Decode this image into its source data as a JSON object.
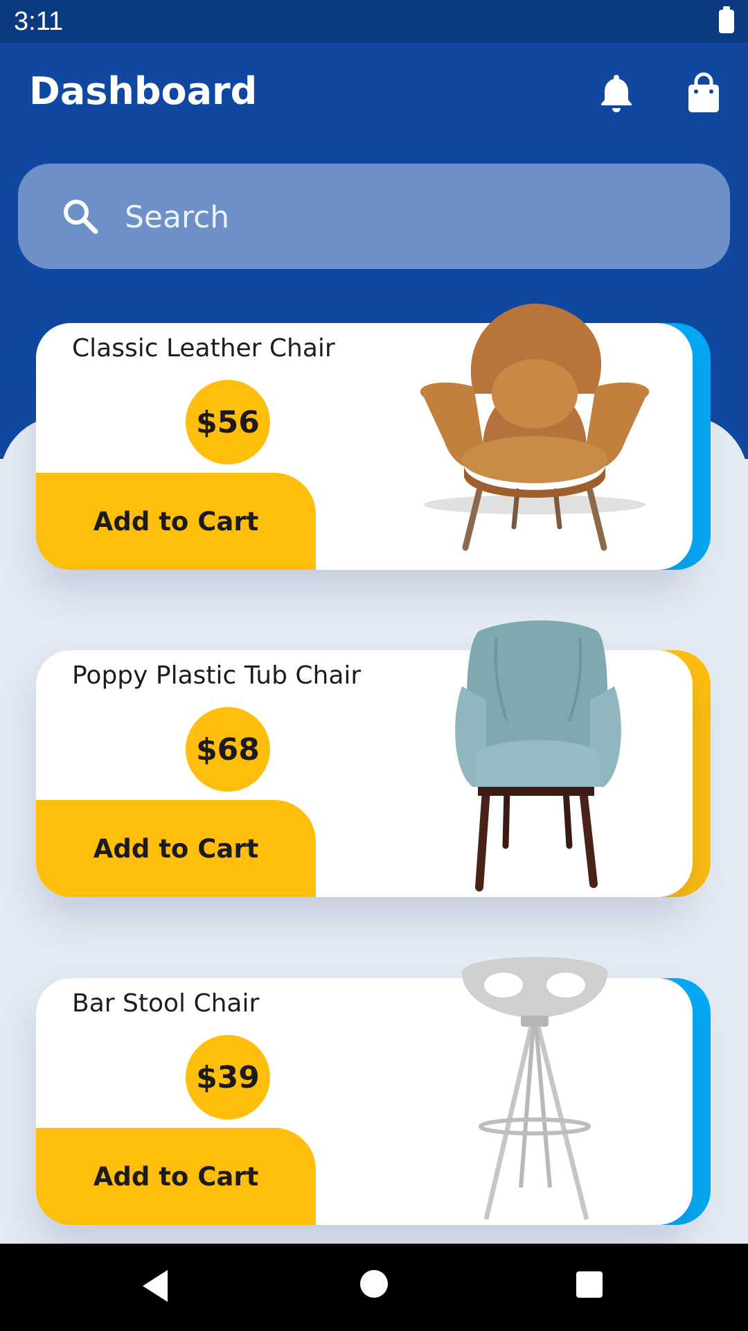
{
  "status_bar": {
    "time": "3:11"
  },
  "header": {
    "title": "Dashboard"
  },
  "search": {
    "placeholder": "Search"
  },
  "colors": {
    "header": "#0f47a1",
    "search": "#6d90c7",
    "yellow": "#ffbe0b",
    "blue_accent": "#03a9f4"
  },
  "products": [
    {
      "name": "Classic Leather Chair",
      "price": "$56",
      "button": "Add to Cart",
      "accent": "blue",
      "image": "lounge-chair-icon"
    },
    {
      "name": "Poppy Plastic Tub Chair",
      "price": "$68",
      "button": "Add to Cart",
      "accent": "yellow",
      "image": "armchair-icon"
    },
    {
      "name": "Bar Stool Chair",
      "price": "$39",
      "button": "Add to Cart",
      "accent": "blue",
      "image": "bar-stool-icon"
    }
  ]
}
